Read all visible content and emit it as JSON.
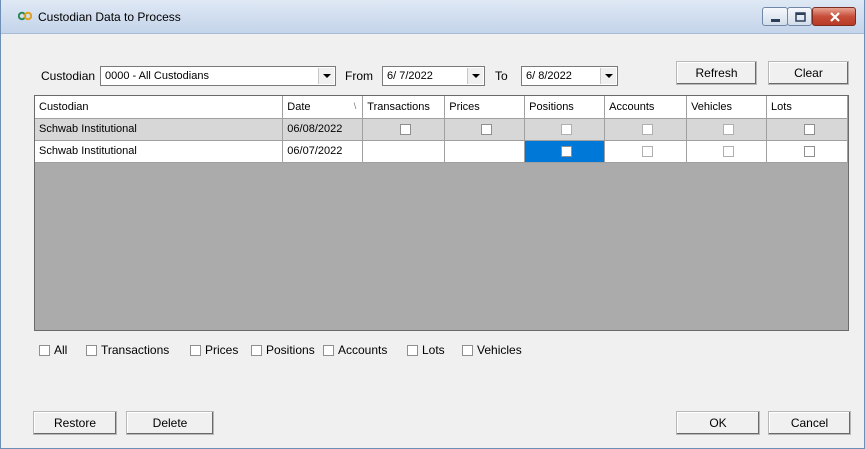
{
  "window": {
    "title": "Custodian Data to Process",
    "controls": [
      "minimize",
      "maximize",
      "close"
    ]
  },
  "toolbar": {
    "custodian_label": "Custodian",
    "custodian_value": "0000 - All Custodians",
    "from_label": "From",
    "from_value": "6/ 7/2022",
    "to_label": "To",
    "to_value": "6/ 8/2022",
    "refresh_label": "Refresh",
    "clear_label": "Clear"
  },
  "grid": {
    "columns": [
      "Custodian",
      "Date",
      "Transactions",
      "Prices",
      "Positions",
      "Accounts",
      "Vehicles",
      "Lots"
    ],
    "sort_glyph": "\\",
    "rows": [
      {
        "custodian": "Schwab Institutional",
        "date": "06/08/2022",
        "checks": {
          "Transactions": true,
          "Prices": true,
          "Positions": true,
          "Accounts": true,
          "Vehicles": true,
          "Lots": true
        }
      },
      {
        "custodian": "Schwab Institutional",
        "date": "06/07/2022",
        "checks": {
          "Transactions": false,
          "Prices": false,
          "Positions": true,
          "Accounts": true,
          "Vehicles": true,
          "Lots": true
        },
        "selected_cell": "Positions"
      }
    ]
  },
  "filters": {
    "all": "All",
    "transactions": "Transactions",
    "prices": "Prices",
    "positions": "Positions",
    "accounts": "Accounts",
    "lots": "Lots",
    "vehicles": "Vehicles"
  },
  "buttons": {
    "restore": "Restore",
    "delete": "Delete",
    "ok": "OK",
    "cancel": "Cancel"
  },
  "colors": {
    "selection": "#0078d7",
    "empty_grid": "#ababab",
    "row_alt": "#d7d7d7"
  }
}
